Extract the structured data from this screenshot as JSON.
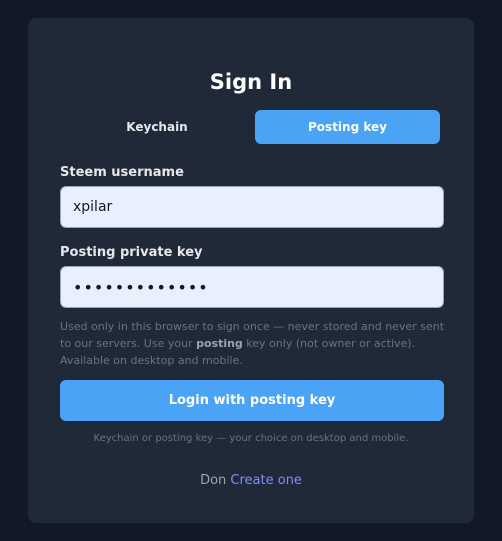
{
  "page": {
    "title": "Sign In"
  },
  "tabs": {
    "keychain": "Keychain",
    "posting_key": "Posting key",
    "active": "posting_key"
  },
  "form": {
    "username_label": "Steem username",
    "username_value": "xpilar",
    "key_label": "Posting private key",
    "key_value": "•••••••••••••",
    "hint_part1": "Used only in this browser to sign once — never stored and never sent to our servers. Use your ",
    "hint_bold": "posting",
    "hint_part2": " key only (not owner or active). Available on desktop and mobile.",
    "login_button": "Login with posting key",
    "footnote": "Keychain or posting key — your choice on desktop and mobile."
  },
  "signup": {
    "prefix": "Don",
    "link": "Create one"
  },
  "colors": {
    "background": "#111827",
    "card": "#1f2937",
    "accent": "#4aa3f5",
    "link": "#818cf8"
  }
}
